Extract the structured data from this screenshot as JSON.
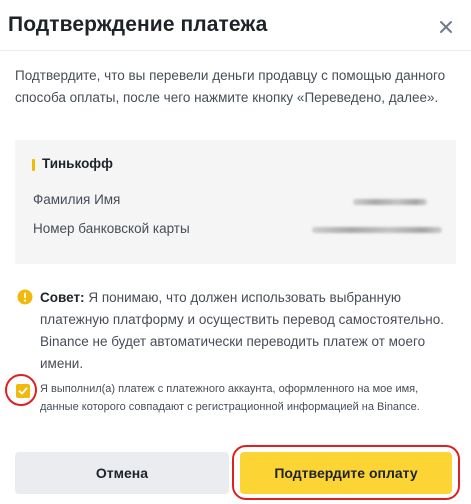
{
  "dialog": {
    "title": "Подтверждение платежа",
    "intro": "Подтвердите, что вы перевели деньги продавцу с помощью данного способа оплаты, после чего нажмите кнопку «Переведено, далее»."
  },
  "payment_method": {
    "name": "Тинькофф",
    "fields": [
      {
        "label": "Фамилия Имя"
      },
      {
        "label": "Номер банковской карты"
      }
    ]
  },
  "tip": {
    "label": "Совет:",
    "text": "Я понимаю, что должен использовать выбранную платежную платформу и осуществить перевод самостоятельно. Binance не будет автоматически переводить платеж от моего имени."
  },
  "agreement": {
    "checked": true,
    "text": "Я выполнил(а) платеж с платежного аккаунта, оформленного на мое имя, данные которого совпадают с регистрационной информацией на Binance."
  },
  "buttons": {
    "cancel": "Отмена",
    "confirm": "Подтвердите оплату"
  },
  "colors": {
    "accent": "#fcd535",
    "brand_yellow": "#f0b90b",
    "highlight_annotation": "#e02020"
  },
  "icons": {
    "close": "close-icon",
    "tip": "warning-icon",
    "check": "checkmark-icon"
  }
}
